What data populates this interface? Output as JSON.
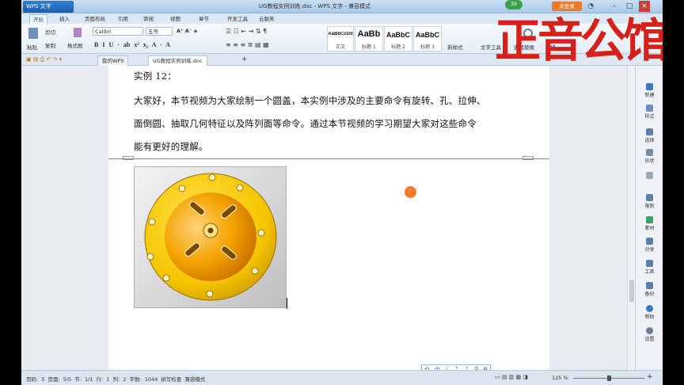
{
  "app": {
    "name": "WPS 文字",
    "window_title": "UG教程实例训练.doc - WPS 文字 - 兼容模式",
    "login_label": "未登录",
    "badge_count": "39"
  },
  "menu_tabs": [
    "开始",
    "插入",
    "页面布局",
    "引用",
    "审阅",
    "视图",
    "章节",
    "开发工具",
    "云服务"
  ],
  "ribbon": {
    "paste": "粘贴",
    "cut": "剪切",
    "copy": "复制",
    "format_painter": "格式刷",
    "font_name": "Calibri",
    "font_size": "五号",
    "styles": [
      {
        "preview": "AaBbCcDd",
        "name": "正文"
      },
      {
        "preview": "AaBb",
        "name": "标题 1"
      },
      {
        "preview": "AaBbC",
        "name": "标题 2"
      },
      {
        "preview": "AaBbC",
        "name": "标题 3"
      }
    ],
    "new_style": "新样式",
    "text_tools": "文字工具",
    "find_replace": "查找替换",
    "select": "选择"
  },
  "doc_tabs": [
    {
      "label": "我的WPS",
      "active": false
    },
    {
      "label": "UG教程实例训练.doc",
      "active": true
    }
  ],
  "document": {
    "heading": "实例 12：",
    "lines": [
      "大家好，本节视频为大家绘制一个圆盖，本实例中涉及的主要命令有旋转、孔、拉伸、",
      "面倒圆、抽取几何特征以及阵列面等命令。通过本节视频的学习期望大家对这些命令",
      "能有更好的理解。"
    ]
  },
  "task_pane": [
    "新建",
    "样式",
    "选择",
    "形状",
    "",
    "限制",
    "素材",
    "分享",
    "工具",
    "备份",
    "帮助",
    "设置"
  ],
  "float_toolbar": [
    "中"
  ],
  "status": {
    "text": "页码: 5  页面: 5/5  节: 1/1  行: 1  列: 2  字数: 1044  拼写检查  兼容模式",
    "zoom": "125 %"
  },
  "watermark": "正音公馆",
  "colors": {
    "accent": "#1b5fae",
    "watermark": "#d8201b",
    "part_yellow": "#f5b800",
    "cursor": "#f07c2c"
  }
}
